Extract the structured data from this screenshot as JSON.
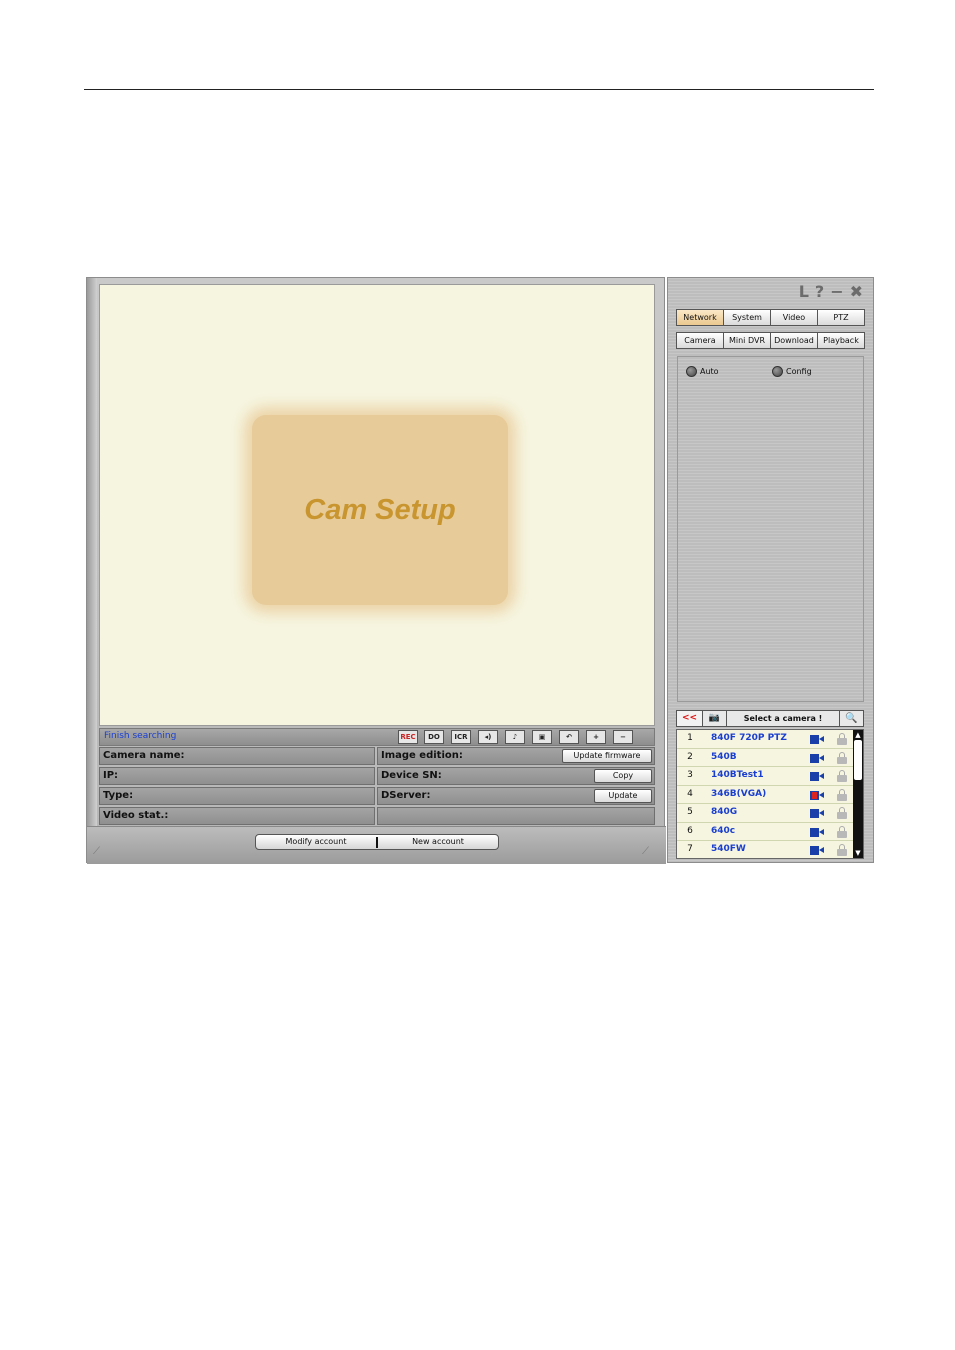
{
  "viewport": {
    "splash_text": "Cam Setup"
  },
  "status": {
    "text": "Finish searching"
  },
  "toolbar": {
    "buttons": [
      {
        "label": "REC",
        "icon": "record-icon"
      },
      {
        "label": "DO",
        "icon": "digital-output-icon"
      },
      {
        "label": "ICR",
        "icon": "icr-icon"
      },
      {
        "label": "◂)",
        "icon": "speaker-icon"
      },
      {
        "label": "♪",
        "icon": "microphone-icon"
      },
      {
        "label": "▣",
        "icon": "snapshot-icon"
      },
      {
        "label": "↶",
        "icon": "rotate-icon"
      },
      {
        "label": "+",
        "icon": "zoom-in-icon"
      },
      {
        "label": "−",
        "icon": "zoom-out-icon"
      }
    ]
  },
  "info": {
    "camera_name_label": "Camera name:",
    "ip_label": "IP:",
    "type_label": "Type:",
    "video_stat_label": "Video stat.:",
    "image_edition_label": "Image edition:",
    "device_sn_label": "Device SN:",
    "dserver_label": "DServer:",
    "update_firmware_label": "Update firmware",
    "copy_label": "Copy",
    "update_label": "Update"
  },
  "accounts": {
    "modify_label": "Modify account",
    "new_label": "New account"
  },
  "window_controls": {
    "restore": "L",
    "help": "?",
    "minimize": "−",
    "close": "✖"
  },
  "tabs_top": [
    "Network",
    "System",
    "Video",
    "PTZ"
  ],
  "tabs_bottom": [
    "Camera",
    "Mini DVR",
    "Download",
    "Playback"
  ],
  "radio": {
    "auto_label": "Auto",
    "config_label": "Config"
  },
  "camera_list": {
    "back_label": "<<",
    "cam_glyph": "📷",
    "title": "Select a camera !",
    "search_glyph": "🔍",
    "items": [
      {
        "num": "1",
        "name": "840F 720P PTZ",
        "alarm": false
      },
      {
        "num": "2",
        "name": "540B",
        "alarm": false
      },
      {
        "num": "3",
        "name": "140BTest1",
        "alarm": false
      },
      {
        "num": "4",
        "name": "346B(VGA)",
        "alarm": true
      },
      {
        "num": "5",
        "name": "840G",
        "alarm": false
      },
      {
        "num": "6",
        "name": "640c",
        "alarm": false
      },
      {
        "num": "7",
        "name": "540FW",
        "alarm": false
      }
    ]
  },
  "colors": {
    "accent_blue": "#1a3fd0",
    "active_tab": "#ecc98f",
    "viewport_bg": "#f6f5e0",
    "splash_bg": "#e7cb99",
    "splash_text": "#c8952e"
  }
}
